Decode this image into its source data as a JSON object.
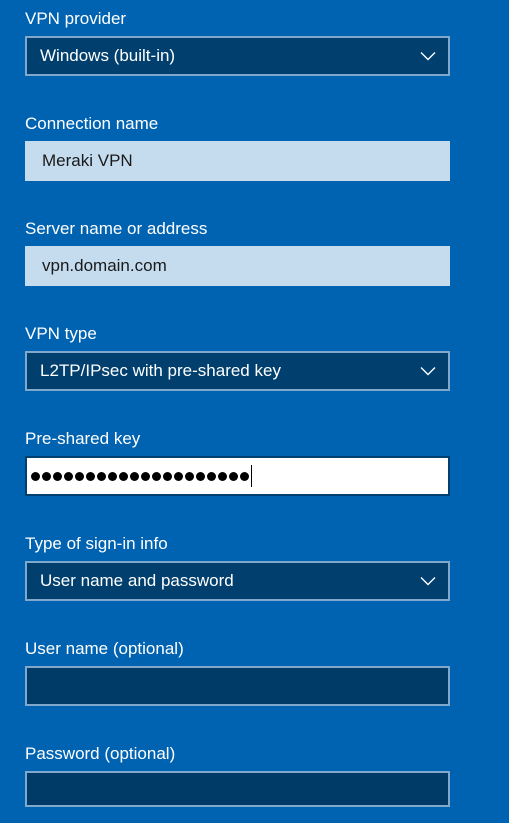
{
  "vpn_provider": {
    "label": "VPN provider",
    "selected": "Windows (built-in)"
  },
  "connection_name": {
    "label": "Connection name",
    "value": "Meraki VPN"
  },
  "server": {
    "label": "Server name or address",
    "value": "vpn.domain.com"
  },
  "vpn_type": {
    "label": "VPN type",
    "selected": "L2TP/IPsec with pre-shared key"
  },
  "pre_shared_key": {
    "label": "Pre-shared key",
    "masked_char_count": 20
  },
  "sign_in_type": {
    "label": "Type of sign-in info",
    "selected": "User name and password"
  },
  "username": {
    "label": "User name (optional)",
    "value": ""
  },
  "password": {
    "label": "Password (optional)",
    "value": ""
  },
  "icons": {
    "dropdown": "chevron-down-icon"
  },
  "colors": {
    "background": "#0063b1",
    "dropdown_bg": "#003f6e",
    "textbox_bg": "#c5dcef",
    "focused_bg": "#ffffff",
    "border": "#7fa8cc"
  }
}
